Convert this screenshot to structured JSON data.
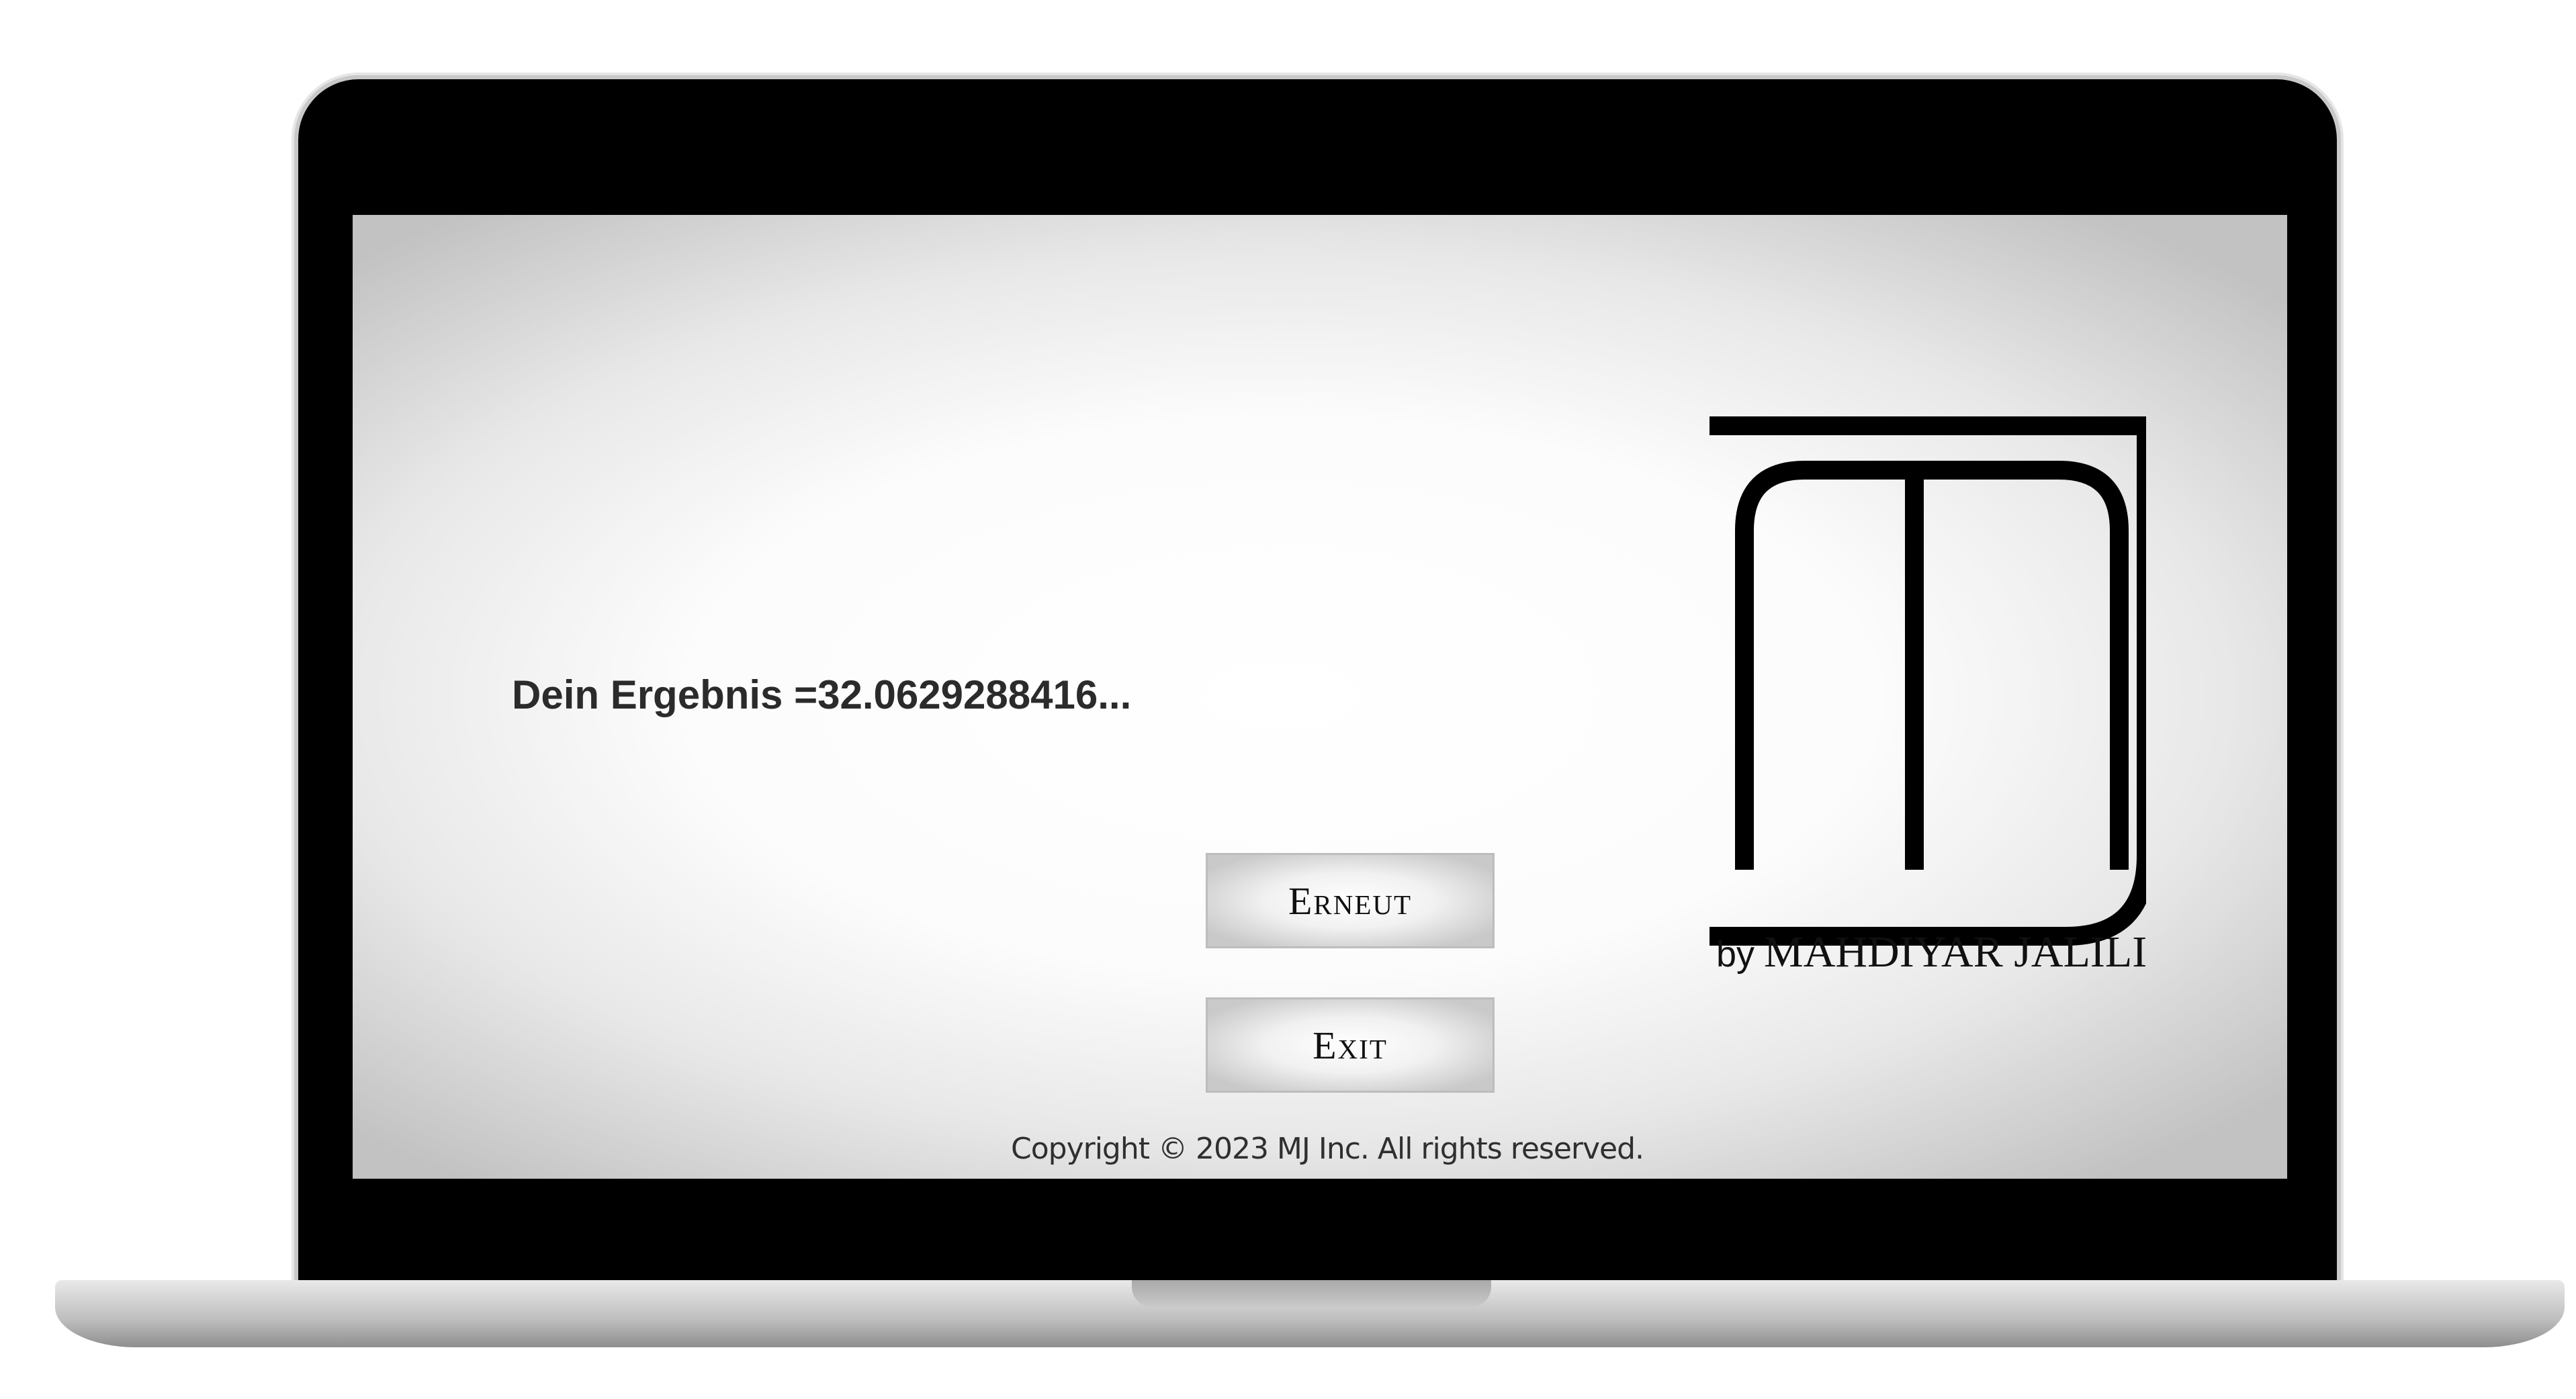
{
  "result": {
    "text": "Dein Ergebnis =32.0629288416..."
  },
  "buttons": {
    "again_label": "Erneut",
    "exit_label": "Exit"
  },
  "footer": {
    "copyright": "Copyright © 2023 MJ Inc. All rights reserved."
  },
  "branding": {
    "logo_icon": "mj-monogram-icon",
    "by": "by",
    "name": "MAHDIYAR JALILI"
  },
  "colors": {
    "bezel": "#000000",
    "text": "#2b2b2b",
    "button_border": "#bdbdbd"
  }
}
